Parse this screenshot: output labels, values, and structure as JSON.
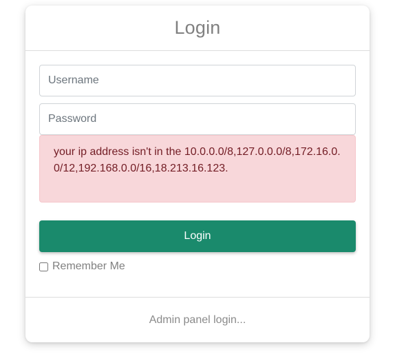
{
  "card": {
    "title": "Login"
  },
  "form": {
    "username_placeholder": "Username",
    "password_placeholder": "Password",
    "error_message": "your ip address isn't in the 10.0.0.0/8,127.0.0.0/8,172.16.0.0/12,192.168.0.0/16,18.213.16.123.",
    "login_label": "Login",
    "remember_label": "Remember Me",
    "remember_checked": false
  },
  "footer": {
    "admin_link": "Admin panel login..."
  },
  "colors": {
    "primary_button": "#1a8a6c",
    "alert_background": "#f8d7da",
    "alert_text": "#721c24",
    "muted_text": "#808080"
  }
}
